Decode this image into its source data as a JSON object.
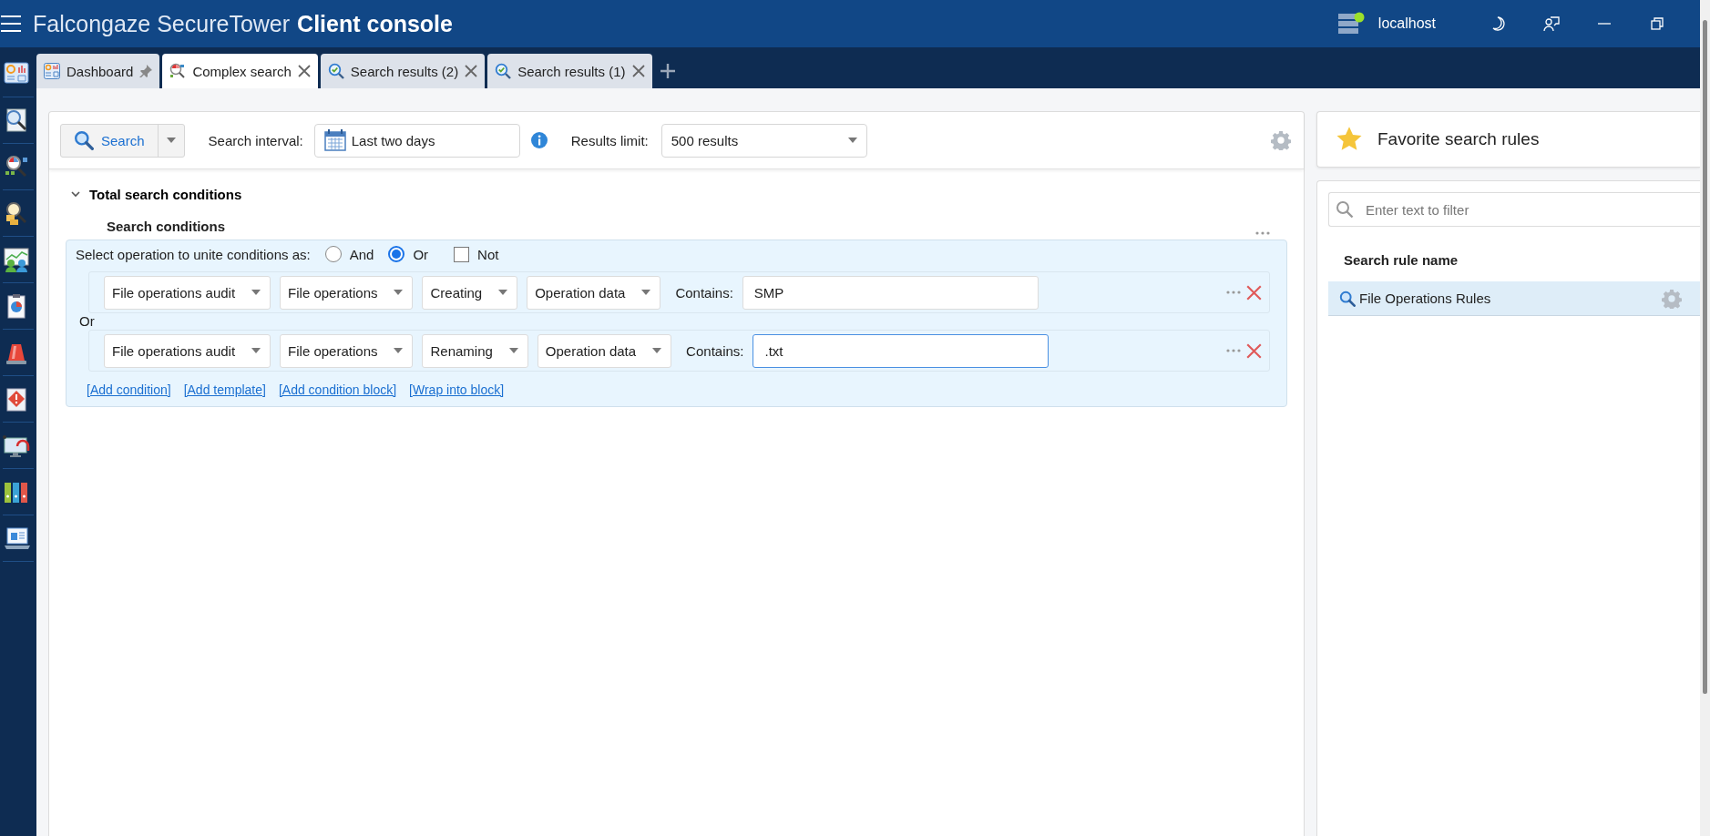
{
  "app_title": {
    "brand": "Falcongaze SecureTower",
    "product": "Client console"
  },
  "server": {
    "name": "localhost",
    "connected": true
  },
  "tabs": [
    {
      "label": "Dashboard",
      "kind": "dashboard",
      "selected": false,
      "pinned": true
    },
    {
      "label": "Complex search",
      "kind": "complex",
      "selected": true,
      "pinned": false
    },
    {
      "label": "Search results (2)",
      "kind": "results",
      "selected": false,
      "pinned": false
    },
    {
      "label": "Search results (1)",
      "kind": "results",
      "selected": false,
      "pinned": false
    }
  ],
  "toolbar": {
    "search_button": "Search",
    "interval_label": "Search interval:",
    "interval": "Last two days",
    "limit_label": "Results limit:",
    "limit": "500 results"
  },
  "conditions": {
    "section_title": "Total search conditions",
    "expanded": true,
    "subtitle": "Search conditions",
    "unite_label": "Select operation to unite conditions as:",
    "operations": [
      {
        "label": "And",
        "selected": false
      },
      {
        "label": "Or",
        "selected": true
      }
    ],
    "not": {
      "label": "Not",
      "checked": false
    },
    "rows": [
      {
        "fields": [
          "File operations audit",
          "File operations",
          "Creating",
          "Operation data"
        ],
        "contains_label": "Contains:",
        "value": "SMP",
        "focused": false
      },
      {
        "fields": [
          "File operations audit",
          "File operations",
          "Renaming",
          "Operation data"
        ],
        "contains_label": "Contains:",
        "value": ".txt",
        "focused": true
      }
    ],
    "joiner": "Or",
    "links": [
      "[Add condition]",
      "[Add template]",
      "[Add condition block]",
      "[Wrap into block]"
    ]
  },
  "favorites": {
    "title": "Favorite search rules",
    "filter_placeholder": "Enter text to filter",
    "column": "Search rule name",
    "rules": [
      {
        "name": "File Operations Rules",
        "selected": true
      }
    ]
  }
}
